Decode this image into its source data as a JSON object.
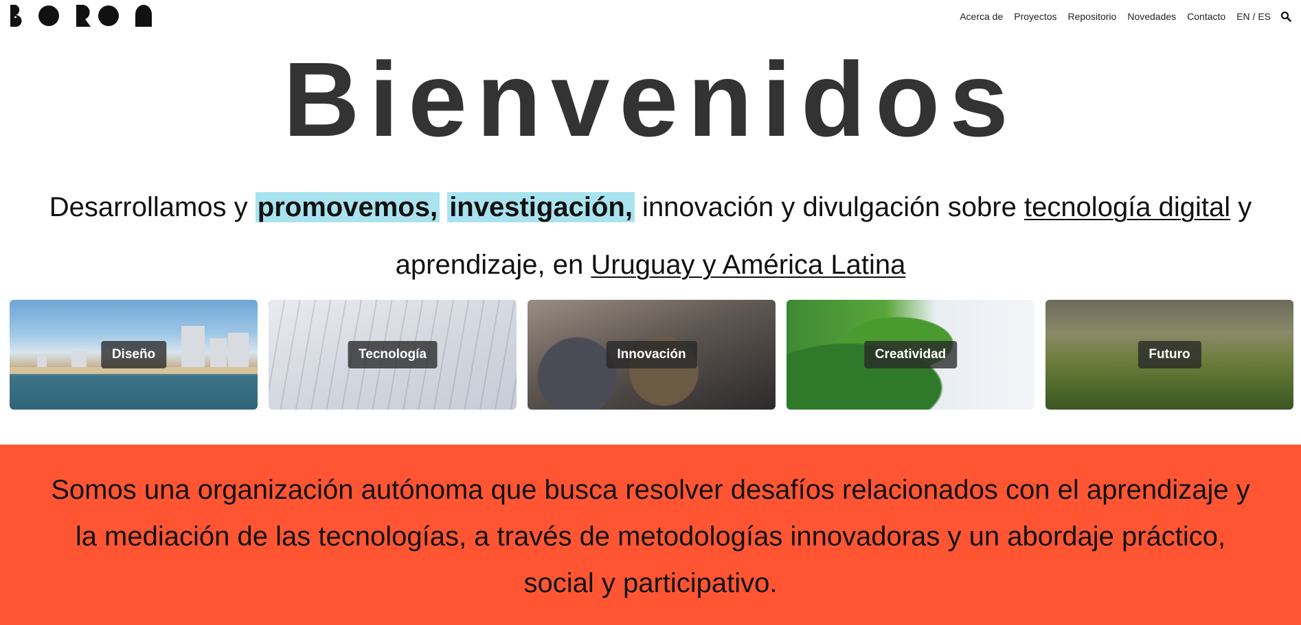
{
  "brand": {
    "logo_alt": "BORON",
    "logo_icon": "boron-logo"
  },
  "nav": {
    "items": [
      {
        "label": "Acerca de"
      },
      {
        "label": "Proyectos"
      },
      {
        "label": "Repositorio"
      },
      {
        "label": "Novedades"
      },
      {
        "label": "Contacto"
      },
      {
        "label": "EN / ES"
      }
    ],
    "search_icon": "search-icon"
  },
  "hero": {
    "title": "Bienvenidos",
    "intro": {
      "part1": "Desarrollamos y ",
      "hl1": "promovemos,",
      "hl2": "investigación,",
      "part2": " innovación y divulgación sobre ",
      "link1": "tecnología digital",
      "part3": " y aprendizaje, en ",
      "link2": "Uruguay y América Latina"
    },
    "highlight_color": "#a8e3ef"
  },
  "cards": [
    {
      "label": "Diseño"
    },
    {
      "label": "Tecnología"
    },
    {
      "label": "Innovación"
    },
    {
      "label": "Creatividad"
    },
    {
      "label": "Futuro"
    }
  ],
  "band": {
    "text": "Somos una organización autónoma que busca resolver desafíos relacionados con el aprendizaje y la mediación de las tecnologías, a través de metodologías innovadoras y un abordaje práctico, social y participativo.",
    "color": "#ff5533"
  }
}
